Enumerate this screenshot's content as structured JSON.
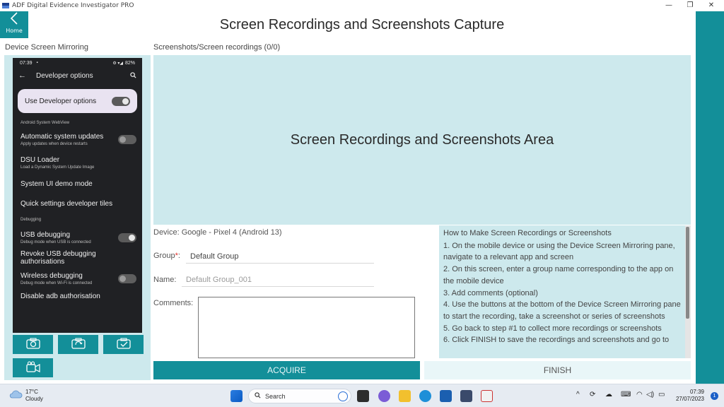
{
  "window": {
    "title": "ADF Digital Evidence Investigator PRO",
    "minimize": "—",
    "maximize": "❐",
    "close": "✕"
  },
  "nav": {
    "home_label": "Home",
    "home_icon": "chevron-left-icon"
  },
  "page": {
    "title": "Screen Recordings and Screenshots Capture"
  },
  "mirror": {
    "label": "Device Screen Mirroring",
    "phone": {
      "time": "07:39",
      "battery": "82%",
      "toolbar_title": "Developer options",
      "dev_toggle_label": "Use Developer options",
      "dev_toggle_on": true,
      "caption_webview": "Android System WebView",
      "auto_updates_title": "Automatic system updates",
      "auto_updates_sub": "Apply updates when device restarts",
      "dsu_title": "DSU Loader",
      "dsu_sub": "Load a Dynamic System Update Image",
      "sysui_title": "System UI demo mode",
      "qs_title": "Quick settings developer tiles",
      "caption_debugging": "Debugging",
      "usb_title": "USB debugging",
      "usb_sub": "Debug mode when USB is connected",
      "revoke_title": "Revoke USB debugging authorisations",
      "wireless_title": "Wireless debugging",
      "wireless_sub": "Debug mode when Wi-Fi is connected",
      "disable_adb_title": "Disable adb authorisation"
    },
    "buttons": [
      {
        "name": "take-screenshot-button",
        "icon": "camera-icon"
      },
      {
        "name": "screenshot-series-button",
        "icon": "camera-refresh-icon"
      },
      {
        "name": "screenshot-scroll-button",
        "icon": "camera-check-icon"
      },
      {
        "name": "record-video-button",
        "icon": "video-camera-icon"
      }
    ]
  },
  "captures": {
    "label": "Screenshots/Screen recordings (0/0)",
    "area_text": "Screen Recordings and Screenshots Area"
  },
  "form": {
    "device": "Device: Google - Pixel 4 (Android 13)",
    "group_label": "Group",
    "required_mark": "*",
    "group_colon": ":",
    "group_value": "Default Group",
    "name_label": "Name:",
    "name_placeholder": "Default Group_001",
    "comments_label": "Comments:",
    "comments_value": ""
  },
  "help": {
    "title": "How to Make Screen Recordings or Screenshots",
    "steps": [
      "1. On the mobile device or using the Device Screen Mirroring pane, navigate to a relevant app and screen",
      "2. On this screen, enter a group name corresponding to the app on the mobile device",
      "3. Add comments (optional)",
      "4. Use the buttons at the bottom of the Device Screen Mirroring pane to start the recording, take a screenshot or series of screenshots",
      "5. Go back to step #1 to collect more recordings or screenshots",
      "6. Click FINISH to save the recordings and screenshots and go to"
    ]
  },
  "actions": {
    "acquire": "ACQUIRE",
    "finish": "FINISH"
  },
  "taskbar": {
    "temperature": "17°C",
    "condition": "Cloudy",
    "search_placeholder": "Search",
    "time": "07:39",
    "date": "27/07/2023",
    "notification_count": "1",
    "tray_up": "^"
  },
  "colors": {
    "accent": "#138f99",
    "panel": "#cde9ed",
    "finish_bg": "#e9f6f8",
    "required": "#e0302a"
  }
}
